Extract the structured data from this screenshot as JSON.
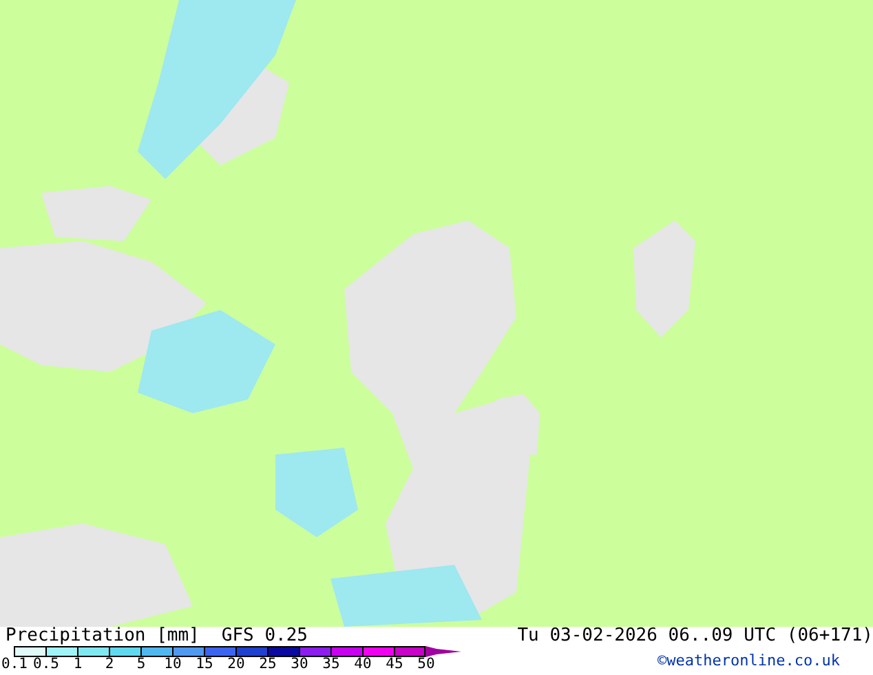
{
  "map": {
    "kind": "precipitation-map"
  },
  "legend": {
    "title": "Precipitation [mm]",
    "model": "GFS 0.25",
    "bins": [
      {
        "color": "#e0fafa"
      },
      {
        "color": "#a0f4f8"
      },
      {
        "color": "#80e8f0"
      },
      {
        "color": "#60d8f0"
      },
      {
        "color": "#50b8f0"
      },
      {
        "color": "#5098f0"
      },
      {
        "color": "#3c64f0"
      },
      {
        "color": "#2040d0"
      },
      {
        "color": "#0a0aa0"
      },
      {
        "color": "#8c1ef0"
      },
      {
        "color": "#c800f0"
      },
      {
        "color": "#f000f0"
      },
      {
        "color": "#c800c8"
      }
    ],
    "labels": [
      "0.1",
      "0.5",
      "1",
      "2",
      "5",
      "10",
      "15",
      "20",
      "25",
      "30",
      "35",
      "40",
      "45",
      "50"
    ]
  },
  "valid_time": "Tu 03-02-2026 06..09 UTC (06+171)",
  "copyright": "©weatheronline.co.uk"
}
